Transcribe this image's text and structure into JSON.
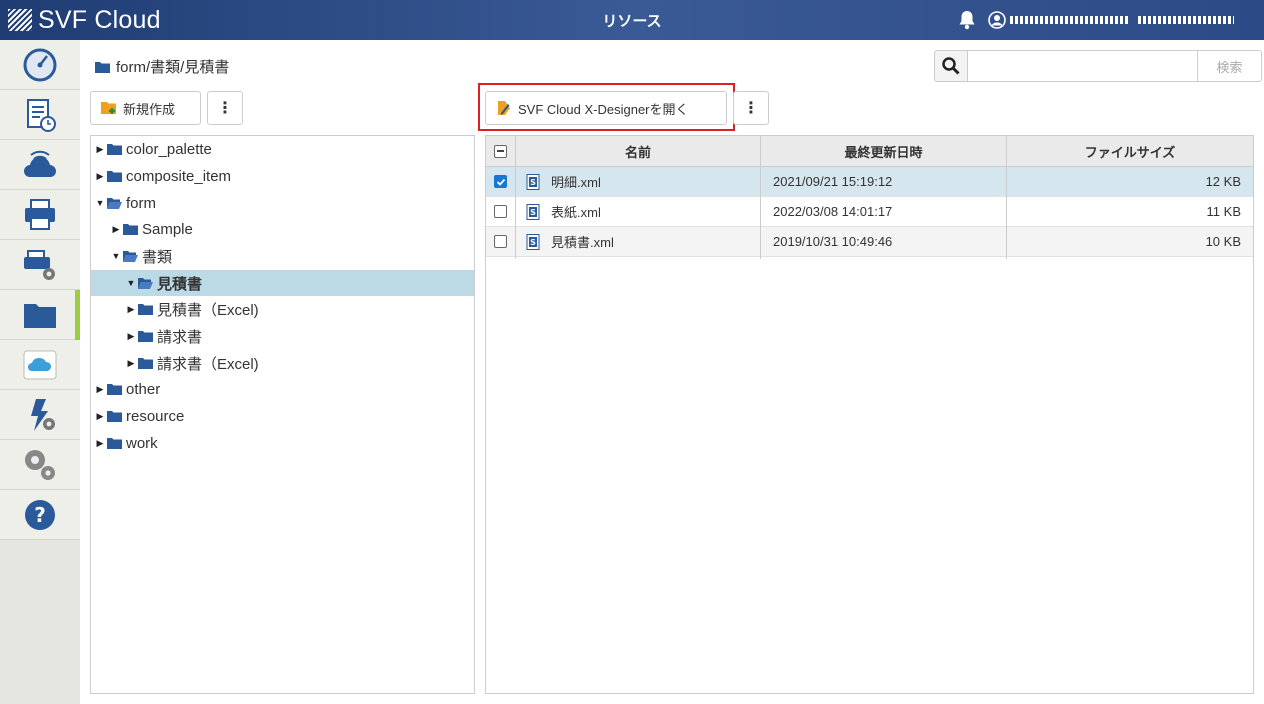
{
  "header": {
    "logo_text": "SVF Cloud",
    "title": "リソース"
  },
  "sidebar": {
    "items": [
      {
        "icon": "dashboard-gauge-icon"
      },
      {
        "icon": "report-schedule-icon"
      },
      {
        "icon": "cloud-connect-icon"
      },
      {
        "icon": "printer-icon"
      },
      {
        "icon": "printer-settings-icon"
      },
      {
        "icon": "folder-icon",
        "active": true
      },
      {
        "icon": "salesforce-cloud-icon"
      },
      {
        "icon": "action-settings-icon"
      },
      {
        "icon": "gears-icon"
      },
      {
        "icon": "help-icon"
      }
    ]
  },
  "breadcrumb": "form/書類/見積書",
  "search": {
    "placeholder": "",
    "submit_label": "検索"
  },
  "toolbar": {
    "new_label": "新規作成",
    "designer_label": "SVF Cloud X-Designerを開く",
    "more_label": "⋮"
  },
  "tree": [
    {
      "label": "color_palette",
      "depth": 0,
      "expanded": false
    },
    {
      "label": "composite_item",
      "depth": 0,
      "expanded": false
    },
    {
      "label": "form",
      "depth": 0,
      "expanded": true
    },
    {
      "label": "Sample",
      "depth": 1,
      "expanded": false
    },
    {
      "label": "書類",
      "depth": 1,
      "expanded": true
    },
    {
      "label": "見積書",
      "depth": 2,
      "expanded": true,
      "selected": true
    },
    {
      "label": "見積書（Excel)",
      "depth": 2,
      "expanded": false
    },
    {
      "label": "請求書",
      "depth": 2,
      "expanded": false
    },
    {
      "label": "請求書（Excel)",
      "depth": 2,
      "expanded": false
    },
    {
      "label": "other",
      "depth": 0,
      "expanded": false
    },
    {
      "label": "resource",
      "depth": 0,
      "expanded": false
    },
    {
      "label": "work",
      "depth": 0,
      "expanded": false
    }
  ],
  "table": {
    "columns": [
      "名前",
      "最終更新日時",
      "ファイルサイズ"
    ],
    "rows": [
      {
        "name": "明細.xml",
        "modified": "2021/09/21 15:19:12",
        "size": "12 KB",
        "checked": true
      },
      {
        "name": "表紙.xml",
        "modified": "2022/03/08 14:01:17",
        "size": "11 KB",
        "checked": false
      },
      {
        "name": "見積書.xml",
        "modified": "2019/10/31 10:49:46",
        "size": "10 KB",
        "checked": false
      }
    ]
  },
  "colors": {
    "header": "#2c4a86",
    "accent_active": "#9ccc45",
    "selection": "#bcd9e6",
    "highlight_frame": "#e02020",
    "folder": "#2a5a9a"
  }
}
